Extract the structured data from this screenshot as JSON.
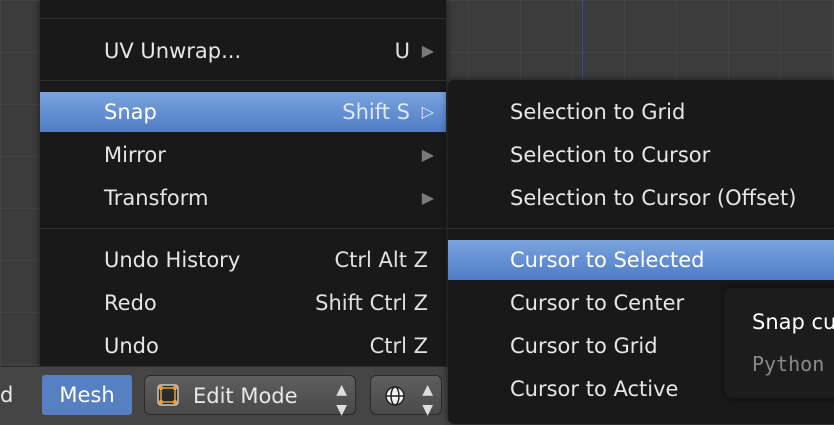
{
  "main_menu": {
    "items": [
      {
        "label": "UV Unwrap...",
        "shortcut": "U",
        "arrow": "▶"
      },
      {
        "label": "Snap",
        "shortcut": "Shift S",
        "arrow": "▷"
      },
      {
        "label": "Mirror",
        "arrow": "▶"
      },
      {
        "label": "Transform",
        "arrow": "▶"
      },
      {
        "label": "Undo History",
        "shortcut": "Ctrl Alt Z"
      },
      {
        "label": "Redo",
        "shortcut": "Shift Ctrl Z"
      },
      {
        "label": "Undo",
        "shortcut": "Ctrl Z"
      }
    ]
  },
  "snap_submenu": {
    "items": [
      {
        "label": "Selection to Grid"
      },
      {
        "label": "Selection to Cursor"
      },
      {
        "label": "Selection to Cursor (Offset)"
      },
      {
        "label": "Cursor to Selected"
      },
      {
        "label": "Cursor to Center"
      },
      {
        "label": "Cursor to Grid"
      },
      {
        "label": "Cursor to Active"
      }
    ]
  },
  "tooltip": {
    "title": "Snap cu",
    "python": "Python"
  },
  "header_bar": {
    "left_label": "d",
    "mesh_menu": "Mesh",
    "mode": "Edit Mode",
    "spinner_arrows": "▲▼"
  },
  "colors": {
    "highlight": "#5680c2",
    "menu_bg": "#191919"
  }
}
